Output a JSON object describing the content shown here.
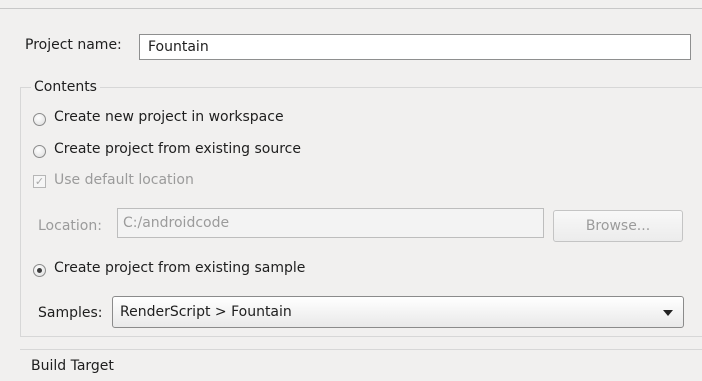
{
  "project": {
    "name_label": "Project name:",
    "name_value": "Fountain"
  },
  "contents": {
    "title": "Contents",
    "options": [
      {
        "label": "Create new project in workspace",
        "selected": false
      },
      {
        "label": "Create project from existing source",
        "selected": false
      },
      {
        "label": "Create project from existing sample",
        "selected": true
      }
    ],
    "use_default_location": {
      "label": "Use default location",
      "checked": true,
      "enabled": false
    },
    "location": {
      "label": "Location:",
      "value": "C:/androidcode",
      "browse_label": "Browse..."
    },
    "samples": {
      "label": "Samples:",
      "selected": "RenderScript > Fountain"
    }
  },
  "build_target": {
    "title": "Build Target"
  }
}
